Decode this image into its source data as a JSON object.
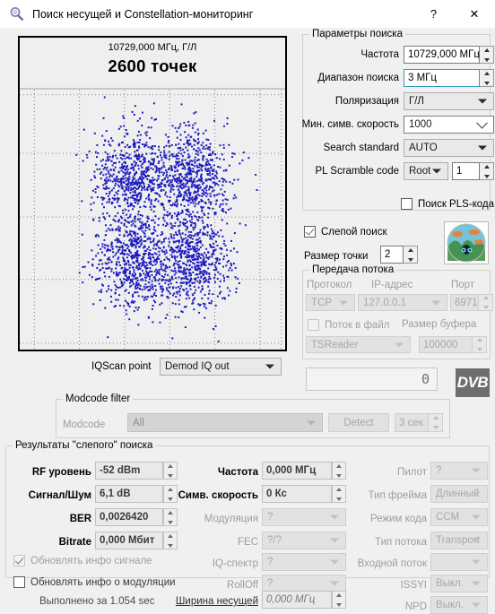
{
  "window": {
    "title": "Поиск несущей и Constellation-мониторинг",
    "icon": "magnifier-icon",
    "help_label": "?",
    "close_label": "✕"
  },
  "plot": {
    "frequency_label": "10729,000 МГц, Г/Л",
    "points_label": "2600 точек",
    "point_color": "#1b1bbf",
    "background": "#efefef",
    "points": 2600
  },
  "search_params": {
    "legend": "Параметры поиска",
    "frequency": {
      "label": "Частота",
      "value": "10729,000 МГц"
    },
    "range": {
      "label": "Диапазон поиска",
      "value": "3 МГц"
    },
    "polarization": {
      "label": "Поляризация",
      "value": "Г/Л"
    },
    "min_symbol_rate": {
      "label": "Мин. симв. скорость",
      "value": "1000"
    },
    "search_standard": {
      "label": "Search standard",
      "value": "AUTO"
    },
    "pl_scramble": {
      "label": "PL Scramble code",
      "mode": "Root",
      "value": "1"
    },
    "pls_search": {
      "label": "Поиск PLS-кода",
      "checked": false
    }
  },
  "blind_search": {
    "label": "Слепой поиск",
    "checked": true,
    "point_size_label": "Размер точки",
    "point_size_value": "2"
  },
  "stream": {
    "legend": "Передача потока",
    "protocol_label": "Протокол",
    "protocol_value": "TCP",
    "ip_label": "IP-адрес",
    "ip_value": "127.0.0.1",
    "port_label": "Порт",
    "port_value": "6971",
    "to_file_label": "Поток в файл",
    "to_file_checked": false,
    "buffer_label": "Размер буфера",
    "buffer_value": "100000",
    "reader_value": "TSReader"
  },
  "iqscan": {
    "label": "IQScan point",
    "value": "Demod IQ out"
  },
  "modcode": {
    "legend": "Modcode filter",
    "label": "Modcode",
    "value": "All",
    "detect_label": "Detect",
    "timeout_value": "3 сек"
  },
  "counter": {
    "value": "0"
  },
  "dvb_logo": "DVB",
  "results": {
    "legend": "Результаты \"слепого\" поиска",
    "col1": [
      {
        "label": "RF уровень",
        "value": "-52 dBm",
        "spinner": true,
        "bold": true
      },
      {
        "label": "Сигнал/Шум",
        "value": "6,1 dB",
        "spinner": true,
        "bold": true
      },
      {
        "label": "BER",
        "value": "0,0026420",
        "spinner": true,
        "bold": true
      },
      {
        "label": "Bitrate",
        "value": "0,000 Мбит",
        "spinner": true,
        "bold": true
      }
    ],
    "col2": [
      {
        "label": "Частота",
        "value": "0,000 МГц",
        "type": "spin",
        "bold": true
      },
      {
        "label": "Симв. скорость",
        "value": "0 Кс",
        "type": "spin",
        "bold": true
      },
      {
        "label": "Модуляция",
        "value": "?",
        "type": "combo"
      },
      {
        "label": "FEC",
        "value": "?/?",
        "type": "combo"
      },
      {
        "label": "IQ-спектр",
        "value": "?",
        "type": "combo"
      },
      {
        "label": "RollOff",
        "value": "?",
        "type": "combo"
      },
      {
        "label": "Ширина несущей",
        "value": "0,000 МГц",
        "type": "spin",
        "link": true
      }
    ],
    "col3": [
      {
        "label": "Пилот",
        "value": "?"
      },
      {
        "label": "Тип фрейма",
        "value": "Длинный"
      },
      {
        "label": "Режим кода",
        "value": "CCM"
      },
      {
        "label": "Тип потока",
        "value": "Transport"
      },
      {
        "label": "Входной поток",
        "value": ""
      },
      {
        "label": "ISSYI",
        "value": "Выкл."
      },
      {
        "label": "NPD",
        "value": "Выкл."
      }
    ],
    "update_signal": {
      "label": "Обновлять инфо сигнале",
      "checked": true
    },
    "update_modulation": {
      "label": "Обновлять инфо о модуляции",
      "checked": false
    },
    "elapsed": "Выполнено за 1.054 sec"
  }
}
